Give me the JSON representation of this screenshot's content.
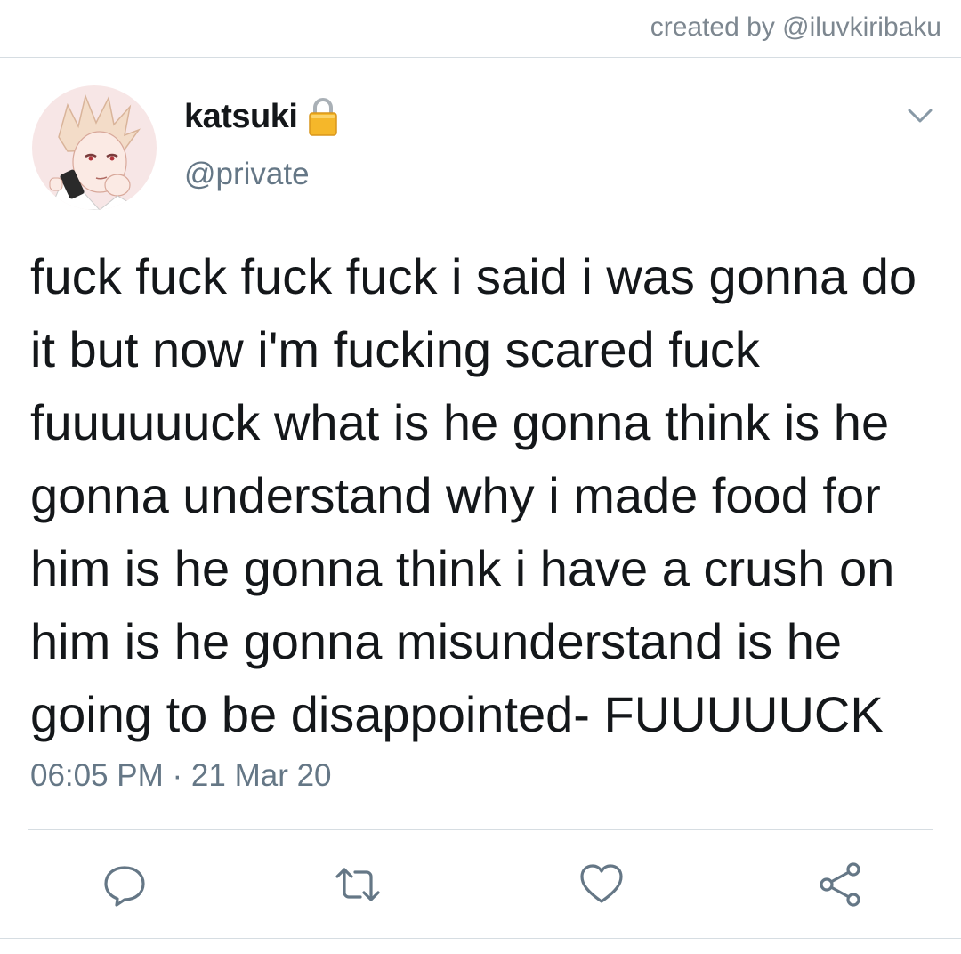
{
  "credit": "created by @iluvkiribaku",
  "user": {
    "display_name": "katsuki",
    "handle": "@private",
    "protected_icon": "lock-icon"
  },
  "tweet": {
    "text": "fuck fuck fuck fuck i said i was gonna do it but now i'm fucking scared fuck fuuuuuuck what is he gonna think is he gonna understand why i made food for him is he gonna think i have a crush on him is he gonna misunderstand is he going to be disappointed- FUUUUUCK",
    "timestamp": "06:05 PM · 21 Mar 20"
  },
  "actions": [
    {
      "icon": "reply-icon"
    },
    {
      "icon": "retweet-icon"
    },
    {
      "icon": "like-icon"
    },
    {
      "icon": "share-icon"
    }
  ],
  "colors": {
    "secondary_text": "#657786",
    "icon": "#657786",
    "divider": "#d6dde2",
    "lock": "#f5b72a"
  }
}
